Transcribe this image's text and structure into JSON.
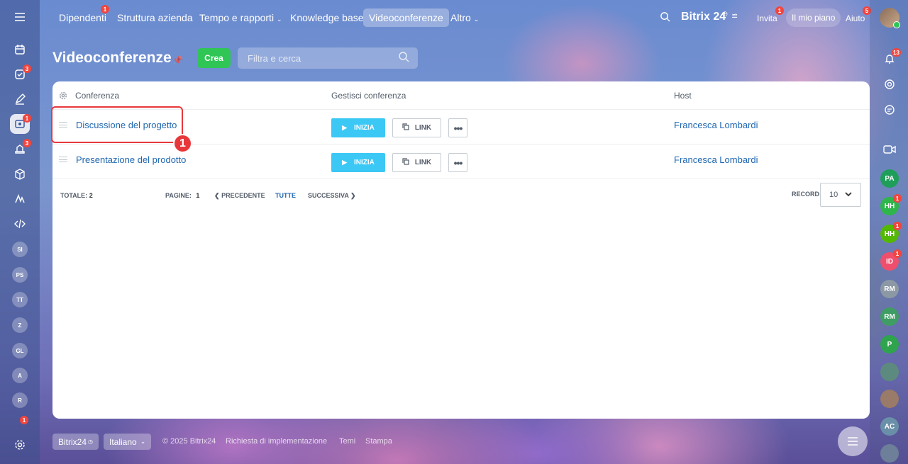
{
  "topnav": {
    "items": [
      {
        "label": "Dipendenti",
        "badge": "1"
      },
      {
        "label": "Struttura azienda"
      },
      {
        "label": "Tempo e rapporti"
      },
      {
        "label": "Knowledge base"
      },
      {
        "label": "Videoconferenze"
      },
      {
        "label": "Altro"
      }
    ],
    "brand": "Bitrix 24",
    "invite_label": "Invita",
    "invite_badge": "1",
    "plan_label": "Il mio piano",
    "help_label": "Aiuto",
    "help_badge": "5"
  },
  "leftbar": {
    "badges": {
      "tasks": "3",
      "videoconf": "1",
      "sites": "3",
      "bottom": "1"
    },
    "avatars": [
      "SI",
      "PS",
      "TT",
      "Z",
      "GL",
      "A",
      "R"
    ]
  },
  "rightbar": {
    "notif_badge": "13",
    "avatars": [
      {
        "initials": "PA",
        "color": "#1f9e5a",
        "badge": ""
      },
      {
        "initials": "HH",
        "color": "#2fb64b",
        "badge": "1"
      },
      {
        "initials": "HH",
        "color": "#55b800",
        "badge": "1"
      },
      {
        "initials": "ID",
        "color": "#f04e6d",
        "badge": "1"
      },
      {
        "initials": "RM",
        "color": "#8c99a5",
        "badge": ""
      },
      {
        "initials": "RM",
        "color": "#3f9d64",
        "badge": ""
      },
      {
        "initials": "P",
        "color": "#2fa34d",
        "badge": ""
      },
      {
        "initials": "AC",
        "color": "#6a8fa8",
        "badge": ""
      }
    ]
  },
  "page": {
    "title": "Videoconferenze",
    "create_label": "Crea",
    "search_placeholder": "Filtra e cerca"
  },
  "table": {
    "headers": {
      "conference": "Conferenza",
      "manage": "Gestisci conferenza",
      "host": "Host"
    },
    "rows": [
      {
        "name": "Discussione del progetto",
        "host": "Francesca Lombardi",
        "start_label": "INIZIA",
        "link_label": "LINK"
      },
      {
        "name": "Presentazione del prodotto",
        "host": "Francesca Lombardi",
        "start_label": "INIZIA",
        "link_label": "LINK"
      }
    ],
    "footer": {
      "total_label": "TOTALE:",
      "total": "2",
      "pages_label": "PAGINE:",
      "page": "1",
      "prev": "PRECEDENTE",
      "all": "TUTTE",
      "next": "SUCCESSIVA",
      "record_label": "RECORD:",
      "record_value": "10"
    }
  },
  "annotation": {
    "step": "1"
  },
  "footer": {
    "brand": "Bitrix24",
    "language": "Italiano",
    "copyright": "© 2025 Bitrix24",
    "implementation": "Richiesta di implementazione",
    "themes": "Temi",
    "print": "Stampa"
  },
  "colors": {
    "accent": "#3bc8f5",
    "create": "#2fc655",
    "link": "#2067b0",
    "badge": "#f2453d",
    "annotation": "#e8373b"
  }
}
